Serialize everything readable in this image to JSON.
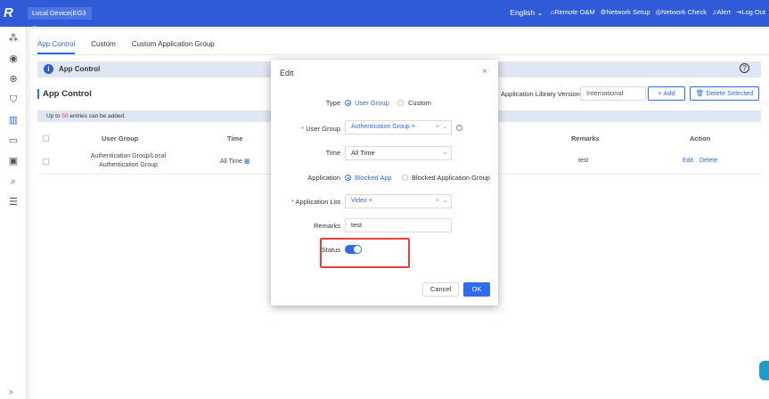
{
  "header": {
    "logo": "R",
    "device_label": "Local Device(EG3",
    "language": "English",
    "nav": [
      "Remote O&M",
      "Network Setup",
      "Network Check",
      "Alert",
      "Log Out"
    ]
  },
  "tabs": [
    "App Control",
    "Custom",
    "Custom Application Group"
  ],
  "info_title": "App Control",
  "section_title": "App Control",
  "library_label": "Application Library Version:",
  "library_value": "International",
  "add_label": "+ Add",
  "delete_selected_label": "Delete Selected",
  "limit": {
    "prefix": "Up to",
    "count": "50",
    "suffix": "entries can be added."
  },
  "table": {
    "headers": {
      "user_group": "User Group",
      "time": "Time",
      "remarks": "Remarks",
      "action": "Action"
    },
    "rows": [
      {
        "user_group_line1": "Authentication Group/Local",
        "user_group_line2": "Authentication Group",
        "time": "All Time",
        "remarks": "test",
        "edit": "Edit",
        "delete": "Delete"
      }
    ]
  },
  "modal": {
    "title": "Edit",
    "close": "×",
    "type_label": "Type",
    "type_options": [
      "User Group",
      "Custom"
    ],
    "user_group_label": "User Group",
    "user_group_value": "Authentication Group",
    "time_label": "Time",
    "time_value": "All Time",
    "application_label": "Application",
    "application_options": [
      "Blocked App",
      "Blocked Application Group"
    ],
    "app_list_label": "Application List",
    "app_list_value": "Video",
    "remarks_label": "Remarks",
    "remarks_value": "test",
    "status_label": "Status",
    "status_on": true,
    "cancel_label": "Cancel",
    "ok_label": "OK"
  },
  "colors": {
    "accent": "#2f6bf0",
    "topbar": "#2f5bd8",
    "highlight": "#e8403a"
  }
}
